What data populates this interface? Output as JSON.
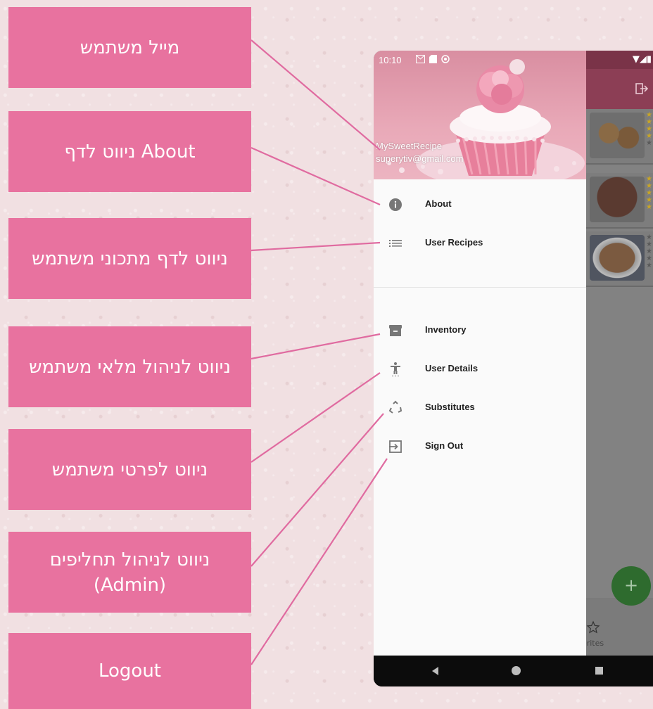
{
  "annotations": [
    {
      "text": "מייל משתמש"
    },
    {
      "text": "ניווט לדף About"
    },
    {
      "text": "ניווט לדף מתכוני משתמש"
    },
    {
      "text": "ניווט לניהול מלאי משתמש"
    },
    {
      "text": "ניווט לפרטי משתמש"
    },
    {
      "text": "ניווט לניהול תחליפים (Admin)"
    },
    {
      "text": "Logout"
    }
  ],
  "colors": {
    "annotation_bg": "#e8729f",
    "connector": "#e06ba0",
    "appbar": "#8c3e55",
    "fab": "#2e6b2e"
  },
  "phone": {
    "status_time": "10:10",
    "drawer": {
      "app_name": "MySweetRecipe",
      "user_email": "superytiv@gmail.com",
      "items": [
        {
          "label": "About",
          "icon": "info-icon"
        },
        {
          "label": "User Recipes",
          "icon": "list-icon"
        },
        {
          "label": "Inventory",
          "icon": "archive-box-icon"
        },
        {
          "label": "User Details",
          "icon": "accessibility-icon"
        },
        {
          "label": "Substitutes",
          "icon": "recycle-icon"
        },
        {
          "label": "Sign Out",
          "icon": "sign-out-icon"
        }
      ]
    },
    "background_app": {
      "bottom_tab_label": "orites",
      "fab_symbol": "+",
      "recipes": [
        {
          "stars": 5,
          "rating_filled": 4
        },
        {
          "stars": 5,
          "rating_filled": 5
        },
        {
          "stars": 5,
          "rating_filled": 0
        }
      ]
    }
  }
}
